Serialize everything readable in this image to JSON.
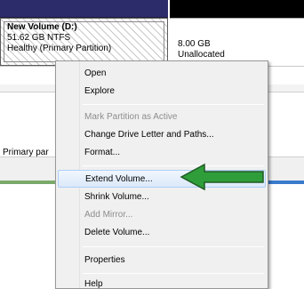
{
  "disk": {
    "partition": {
      "name": "New Volume  (D:)",
      "size": "51.62 GB NTFS",
      "status": "Healthy (Primary Partition)"
    },
    "unallocated": {
      "size": "8.00 GB",
      "status": "Unallocated"
    }
  },
  "legend": {
    "primary_label": "Primary par"
  },
  "context_menu": {
    "items": [
      {
        "label": "Open",
        "enabled": true
      },
      {
        "label": "Explore",
        "enabled": true
      },
      {
        "label": "Mark Partition as Active",
        "enabled": false
      },
      {
        "label": "Change Drive Letter and Paths...",
        "enabled": true
      },
      {
        "label": "Format...",
        "enabled": true
      },
      {
        "label": "Extend Volume...",
        "enabled": true,
        "highlighted": true
      },
      {
        "label": "Shrink Volume...",
        "enabled": true
      },
      {
        "label": "Add Mirror...",
        "enabled": false
      },
      {
        "label": "Delete Volume...",
        "enabled": true
      },
      {
        "label": "Properties",
        "enabled": true
      },
      {
        "label": "Help",
        "enabled": true
      }
    ]
  },
  "annotation": {
    "arrow_icon": "left-arrow-icon",
    "arrow_color": "#2f9e3a"
  }
}
